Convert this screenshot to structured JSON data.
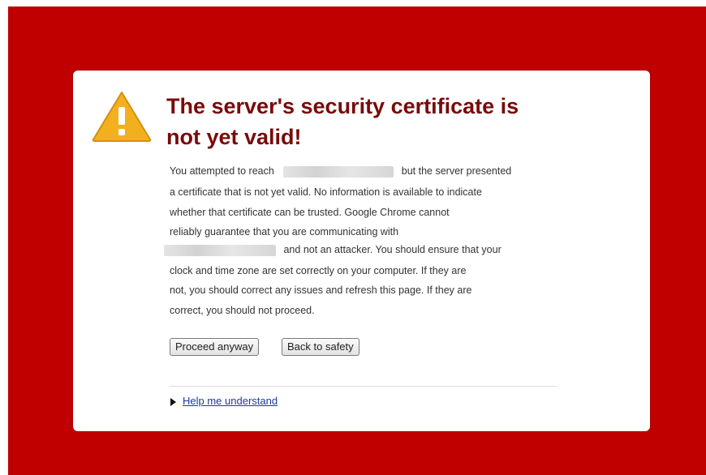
{
  "colors": {
    "frame_background": "#c00000",
    "card_background": "#ffffff",
    "title_color": "#7a0a0a",
    "link_color": "#1a3d99",
    "warning_icon": "#f2b01e"
  },
  "icons": {
    "warning": "warning-triangle-icon",
    "expand": "disclosure-triangle-icon"
  },
  "title": {
    "line1": "The server's security certificate is",
    "line2": "not yet valid!"
  },
  "message": {
    "line1_before": "You attempted to reach",
    "line1_after": "but the server presented",
    "line2": "a certificate that is not yet valid. No information is available to indicate",
    "line3": "whether that certificate can be trusted. Google Chrome cannot",
    "line4": "reliably guarantee that you are communicating with",
    "line5_after": "and not an attacker. You should ensure that your",
    "line6": "clock and time zone are set correctly on your computer. If they are",
    "line7": "not, you should correct any issues and refresh this page. If they are",
    "line8": "correct, you should not proceed."
  },
  "buttons": {
    "proceed": "Proceed anyway",
    "back": "Back to safety"
  },
  "help_link": "Help me understand"
}
